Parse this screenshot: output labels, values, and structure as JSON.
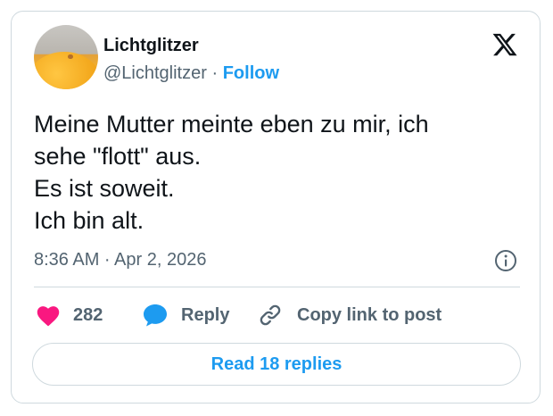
{
  "author": {
    "display_name": "Lichtglitzer",
    "handle": "@Lichtglitzer",
    "separator": "·",
    "follow_label": "Follow"
  },
  "tweet": {
    "lines": [
      "Meine Mutter meinte eben zu mir, ich",
      "sehe \"flott\" aus.",
      "Es ist soweit.",
      "Ich bin alt."
    ],
    "timestamp": "8:36 AM · Apr 2, 2026"
  },
  "actions": {
    "like_count": "282",
    "reply_label": "Reply",
    "copy_link_label": "Copy link to post"
  },
  "read_replies_label": "Read 18 replies",
  "icons": {
    "brand": "x-logo-icon",
    "info": "info-icon",
    "like": "heart-icon",
    "reply": "speech-bubble-icon",
    "copy": "link-icon"
  },
  "colors": {
    "accent": "#1d9bf0",
    "like": "#f91880",
    "text": "#0f1419",
    "secondary": "#536471",
    "border": "#cfd9de"
  }
}
